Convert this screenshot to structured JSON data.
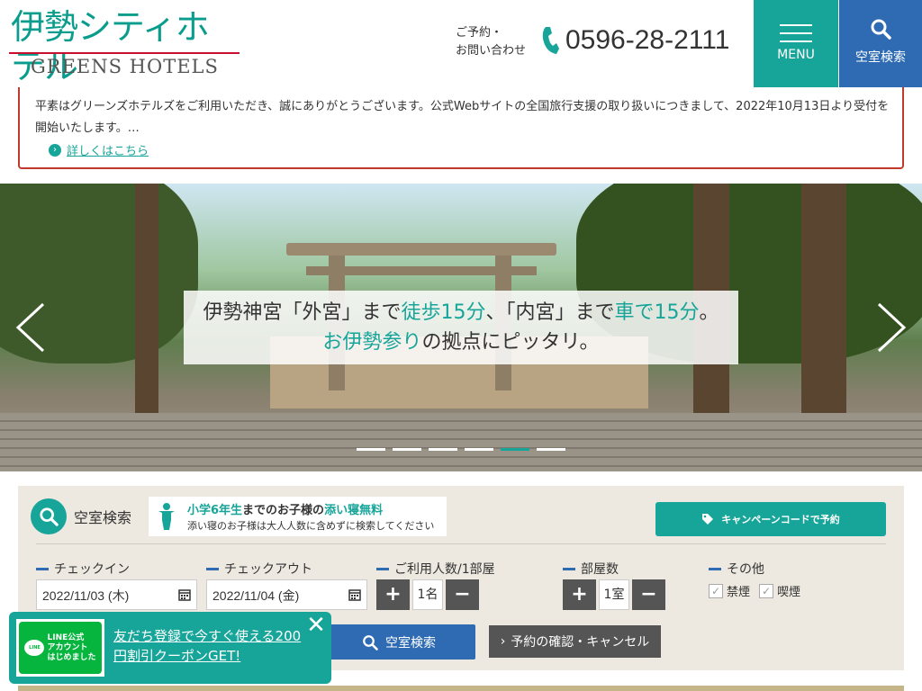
{
  "header": {
    "logo_jp": "伊勢シティホテル",
    "logo_en": "GREENS HOTELS",
    "contact_label_1": "ご予約・",
    "contact_label_2": "お問い合わせ",
    "phone": "0596-28-2111",
    "menu_label": "MENU",
    "search_label": "空室検索"
  },
  "notice": {
    "body": "平素はグリーンズホテルズをご利用いただき、誠にありがとうございます。公式Webサイトの全国旅行支援の取り扱いにつきまして、2022年10月13日より受付を開始いたします。…",
    "link": "詳しくはこちら"
  },
  "hero": {
    "line1_a": "伊勢神宮「外宮」まで",
    "line1_b": "徒歩15分",
    "line1_c": "、「内宮」まで",
    "line1_d": "車で15分",
    "line1_e": "。",
    "line2_a": "お伊勢参り",
    "line2_b": "の拠点にピッタリ。",
    "slide_count": 6,
    "active_slide": 5
  },
  "search": {
    "title": "空室検索",
    "kids_line1_a": "小学6年生",
    "kids_line1_b": "までのお子様の",
    "kids_line1_c": "添い寝無料",
    "kids_line2": "添い寝のお子様は大人人数に含めずに検索してください",
    "campaign_btn": "キャンペーンコードで予約",
    "checkin_label": "チェックイン",
    "checkin_value": "2022/11/03 (木)",
    "checkout_label": "チェックアウト",
    "checkout_value": "2022/11/04 (金)",
    "guests_label": "ご利用人数/1部屋",
    "guests_value": "1名",
    "rooms_label": "部屋数",
    "rooms_value": "1室",
    "other_label": "その他",
    "nonsmoking": "禁煙",
    "smoking": "喫煙",
    "submit": "空室検索",
    "confirm": "予約の確認・キャンセル"
  },
  "line_popup": {
    "logo_text_1": "LINE公式",
    "logo_text_2": "アカウント",
    "logo_text_3": "はじめました",
    "message": "友だち登録で今すぐ使える200円割引クーポンGET!",
    "close": "✕"
  },
  "colors": {
    "teal": "#17a59a",
    "blue": "#2e6bb3",
    "red": "#c0392b",
    "panel_bg": "#ede9e0"
  }
}
